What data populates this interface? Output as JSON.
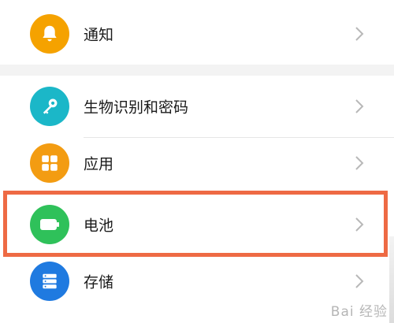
{
  "settings": {
    "items": [
      {
        "id": "notifications",
        "label": "通知",
        "icon": "bell-icon",
        "color": "#f5a200"
      },
      {
        "id": "biometrics",
        "label": "生物识别和密码",
        "icon": "key-icon",
        "color": "#1bb7c8"
      },
      {
        "id": "apps",
        "label": "应用",
        "icon": "apps-grid-icon",
        "color": "#f39c12"
      },
      {
        "id": "battery",
        "label": "电池",
        "icon": "battery-icon",
        "color": "#2fc15a"
      },
      {
        "id": "storage",
        "label": "存储",
        "icon": "storage-icon",
        "color": "#1f7ae0"
      }
    ]
  },
  "highlight": {
    "color": "#ee6a44",
    "target": "battery"
  },
  "watermark": {
    "text": "Bai  经验"
  }
}
